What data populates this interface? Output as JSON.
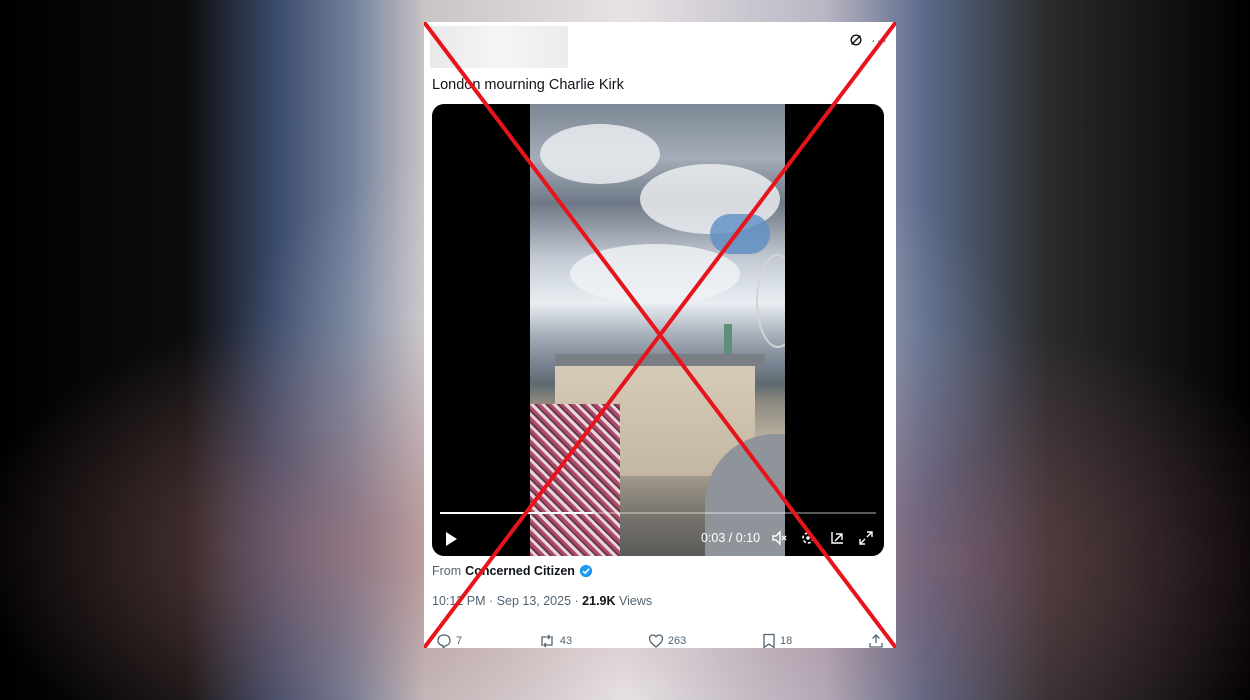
{
  "tweet": {
    "text": "London mourning Charlie Kirk",
    "from_label": "From",
    "from_account": "Concerned Citizen",
    "time": "10:12 PM",
    "date": "Sep 13, 2025",
    "views_count": "21.9K",
    "views_label": "Views",
    "separator": "·"
  },
  "video": {
    "time_display": "0:03 / 0:10",
    "progress": 0.35
  },
  "actions": {
    "replies": "7",
    "reposts": "43",
    "likes": "263",
    "bookmarks": "18"
  },
  "colors": {
    "cross": "#e8141c",
    "verified": "#1d9bf0"
  }
}
